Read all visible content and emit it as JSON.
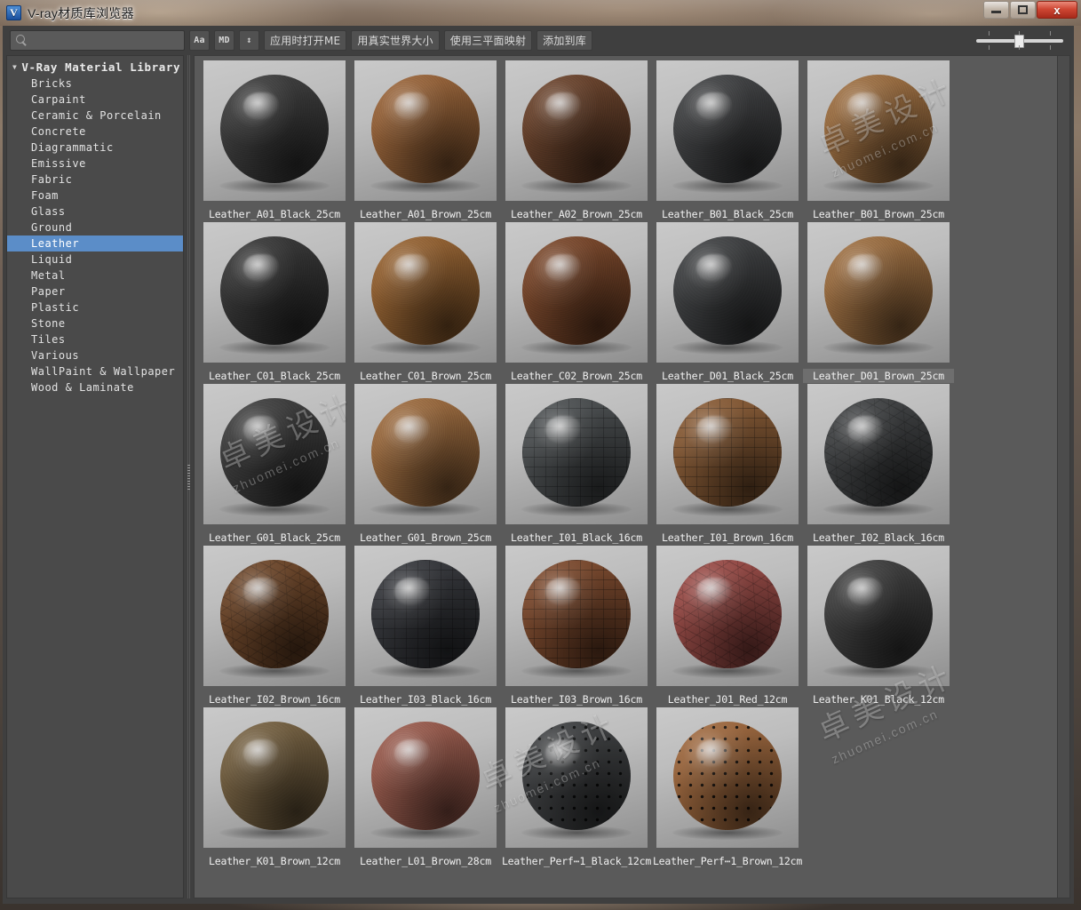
{
  "window": {
    "title": "V-ray材质库浏览器",
    "app_icon": "vray-logo-icon",
    "minimize_label": "",
    "maximize_label": "",
    "close_label": "x"
  },
  "toolbar": {
    "search": {
      "placeholder": "",
      "value": "",
      "icon": "search-icon"
    },
    "buttons": [
      {
        "name": "text-size-button",
        "label": "Aa"
      },
      {
        "name": "material-display-button",
        "label": "MD"
      },
      {
        "name": "sort-order-button",
        "label": "↕"
      },
      {
        "name": "open-me-on-apply-button",
        "label": "应用时打开ME"
      },
      {
        "name": "real-world-scale-button",
        "label": "用真实世界大小"
      },
      {
        "name": "triplanar-mapping-button",
        "label": "使用三平面映射"
      },
      {
        "name": "add-to-library-button",
        "label": "添加到库"
      }
    ],
    "zoom_slider": {
      "value": 50,
      "min": 0,
      "max": 100
    }
  },
  "sidebar": {
    "root_label": "V-Ray Material Library",
    "selected": "Leather",
    "items": [
      {
        "label": "Bricks"
      },
      {
        "label": "Carpaint"
      },
      {
        "label": "Ceramic & Porcelain"
      },
      {
        "label": "Concrete"
      },
      {
        "label": "Diagrammatic"
      },
      {
        "label": "Emissive"
      },
      {
        "label": "Fabric"
      },
      {
        "label": "Foam"
      },
      {
        "label": "Glass"
      },
      {
        "label": "Ground"
      },
      {
        "label": "Leather"
      },
      {
        "label": "Liquid"
      },
      {
        "label": "Metal"
      },
      {
        "label": "Paper"
      },
      {
        "label": "Plastic"
      },
      {
        "label": "Stone"
      },
      {
        "label": "Tiles"
      },
      {
        "label": "Various"
      },
      {
        "label": "WallPaint & Wallpaper"
      },
      {
        "label": "Wood & Laminate"
      }
    ]
  },
  "colors": {
    "black_leather": "#3a3a3a",
    "brown_leather": "#9c6436",
    "dark_brown_leather": "#6b4128",
    "tan_leather": "#a87140",
    "red_leather": "#9e4a45",
    "accent_selection": "#5b8dc8",
    "panel_bg": "#5a5a5a",
    "sidebar_bg": "#4a4a4a",
    "toolbar_bg": "#3f3f3f"
  },
  "grid": {
    "items": [
      {
        "label": "Leather_A01_Black_25cm",
        "color": "#3a3a3a",
        "texture": "grain",
        "selected": false
      },
      {
        "label": "Leather_A01_Brown_25cm",
        "color": "#9c6436",
        "texture": "grain",
        "selected": false
      },
      {
        "label": "Leather_A02_Brown_25cm",
        "color": "#6b4128",
        "texture": "grain",
        "selected": false
      },
      {
        "label": "Leather_B01_Black_25cm",
        "color": "#3e4042",
        "texture": "grain",
        "selected": false
      },
      {
        "label": "Leather_B01_Brown_25cm",
        "color": "#a1703f",
        "texture": "grain",
        "selected": false
      },
      {
        "label": "Leather_C01_Black_25cm",
        "color": "#343434",
        "texture": "grain",
        "selected": false
      },
      {
        "label": "Leather_C01_Brown_25cm",
        "color": "#99632f",
        "texture": "grain",
        "selected": false
      },
      {
        "label": "Leather_C02_Brown_25cm",
        "color": "#7b4526",
        "texture": "grain",
        "selected": false
      },
      {
        "label": "Leather_D01_Black_25cm",
        "color": "#3c3e40",
        "texture": "smooth",
        "selected": false
      },
      {
        "label": "Leather_D01_Brown_25cm",
        "color": "#a1703f",
        "texture": "grain",
        "selected": true
      },
      {
        "label": "Leather_G01_Black_25cm",
        "color": "#3b3b3b",
        "texture": "smooth",
        "selected": false
      },
      {
        "label": "Leather_G01_Brown_25cm",
        "color": "#a06c3c",
        "texture": "grain",
        "selected": false
      },
      {
        "label": "Leather_I01_Black_16cm",
        "color": "#4a4e50",
        "texture": "croc",
        "selected": false
      },
      {
        "label": "Leather_I01_Brown_16cm",
        "color": "#8b5b33",
        "texture": "croc",
        "selected": false
      },
      {
        "label": "Leather_I02_Black_16cm",
        "color": "#3e4042",
        "texture": "crack",
        "selected": false
      },
      {
        "label": "Leather_I02_Brown_16cm",
        "color": "#6f4526",
        "texture": "crack",
        "selected": false
      },
      {
        "label": "Leather_I03_Black_16cm",
        "color": "#33353a",
        "texture": "croc",
        "selected": false
      },
      {
        "label": "Leather_I03_Brown_16cm",
        "color": "#7e482a",
        "texture": "croc",
        "selected": false
      },
      {
        "label": "Leather_J01_Red_12cm",
        "color": "#9e4a45",
        "texture": "crack",
        "selected": false
      },
      {
        "label": "Leather_K01_Black_12cm",
        "color": "#3c3c3c",
        "texture": "smooth",
        "selected": false
      },
      {
        "label": "Leather_K01_Brown_12cm",
        "color": "#77613f",
        "texture": "smooth",
        "selected": false
      },
      {
        "label": "Leather_L01_Brown_28cm",
        "color": "#9d5b4c",
        "texture": "grain",
        "selected": false
      },
      {
        "label": "Leather_Perf⋯1_Black_12cm",
        "color": "#3d3f41",
        "texture": "perf",
        "selected": false
      },
      {
        "label": "Leather_Perf⋯1_Brown_12cm",
        "color": "#a3693c",
        "texture": "perf",
        "selected": false
      }
    ]
  },
  "watermarks": [
    {
      "big": "卓美设计",
      "sm": "zhuomei.com.cn"
    },
    {
      "big": "卓美设计",
      "sm": "zhuomei.com.cn"
    },
    {
      "big": "卓美设计",
      "sm": "zhuomei.com.cn"
    },
    {
      "big": "卓美设计",
      "sm": "zhuomei.com.cn"
    }
  ]
}
